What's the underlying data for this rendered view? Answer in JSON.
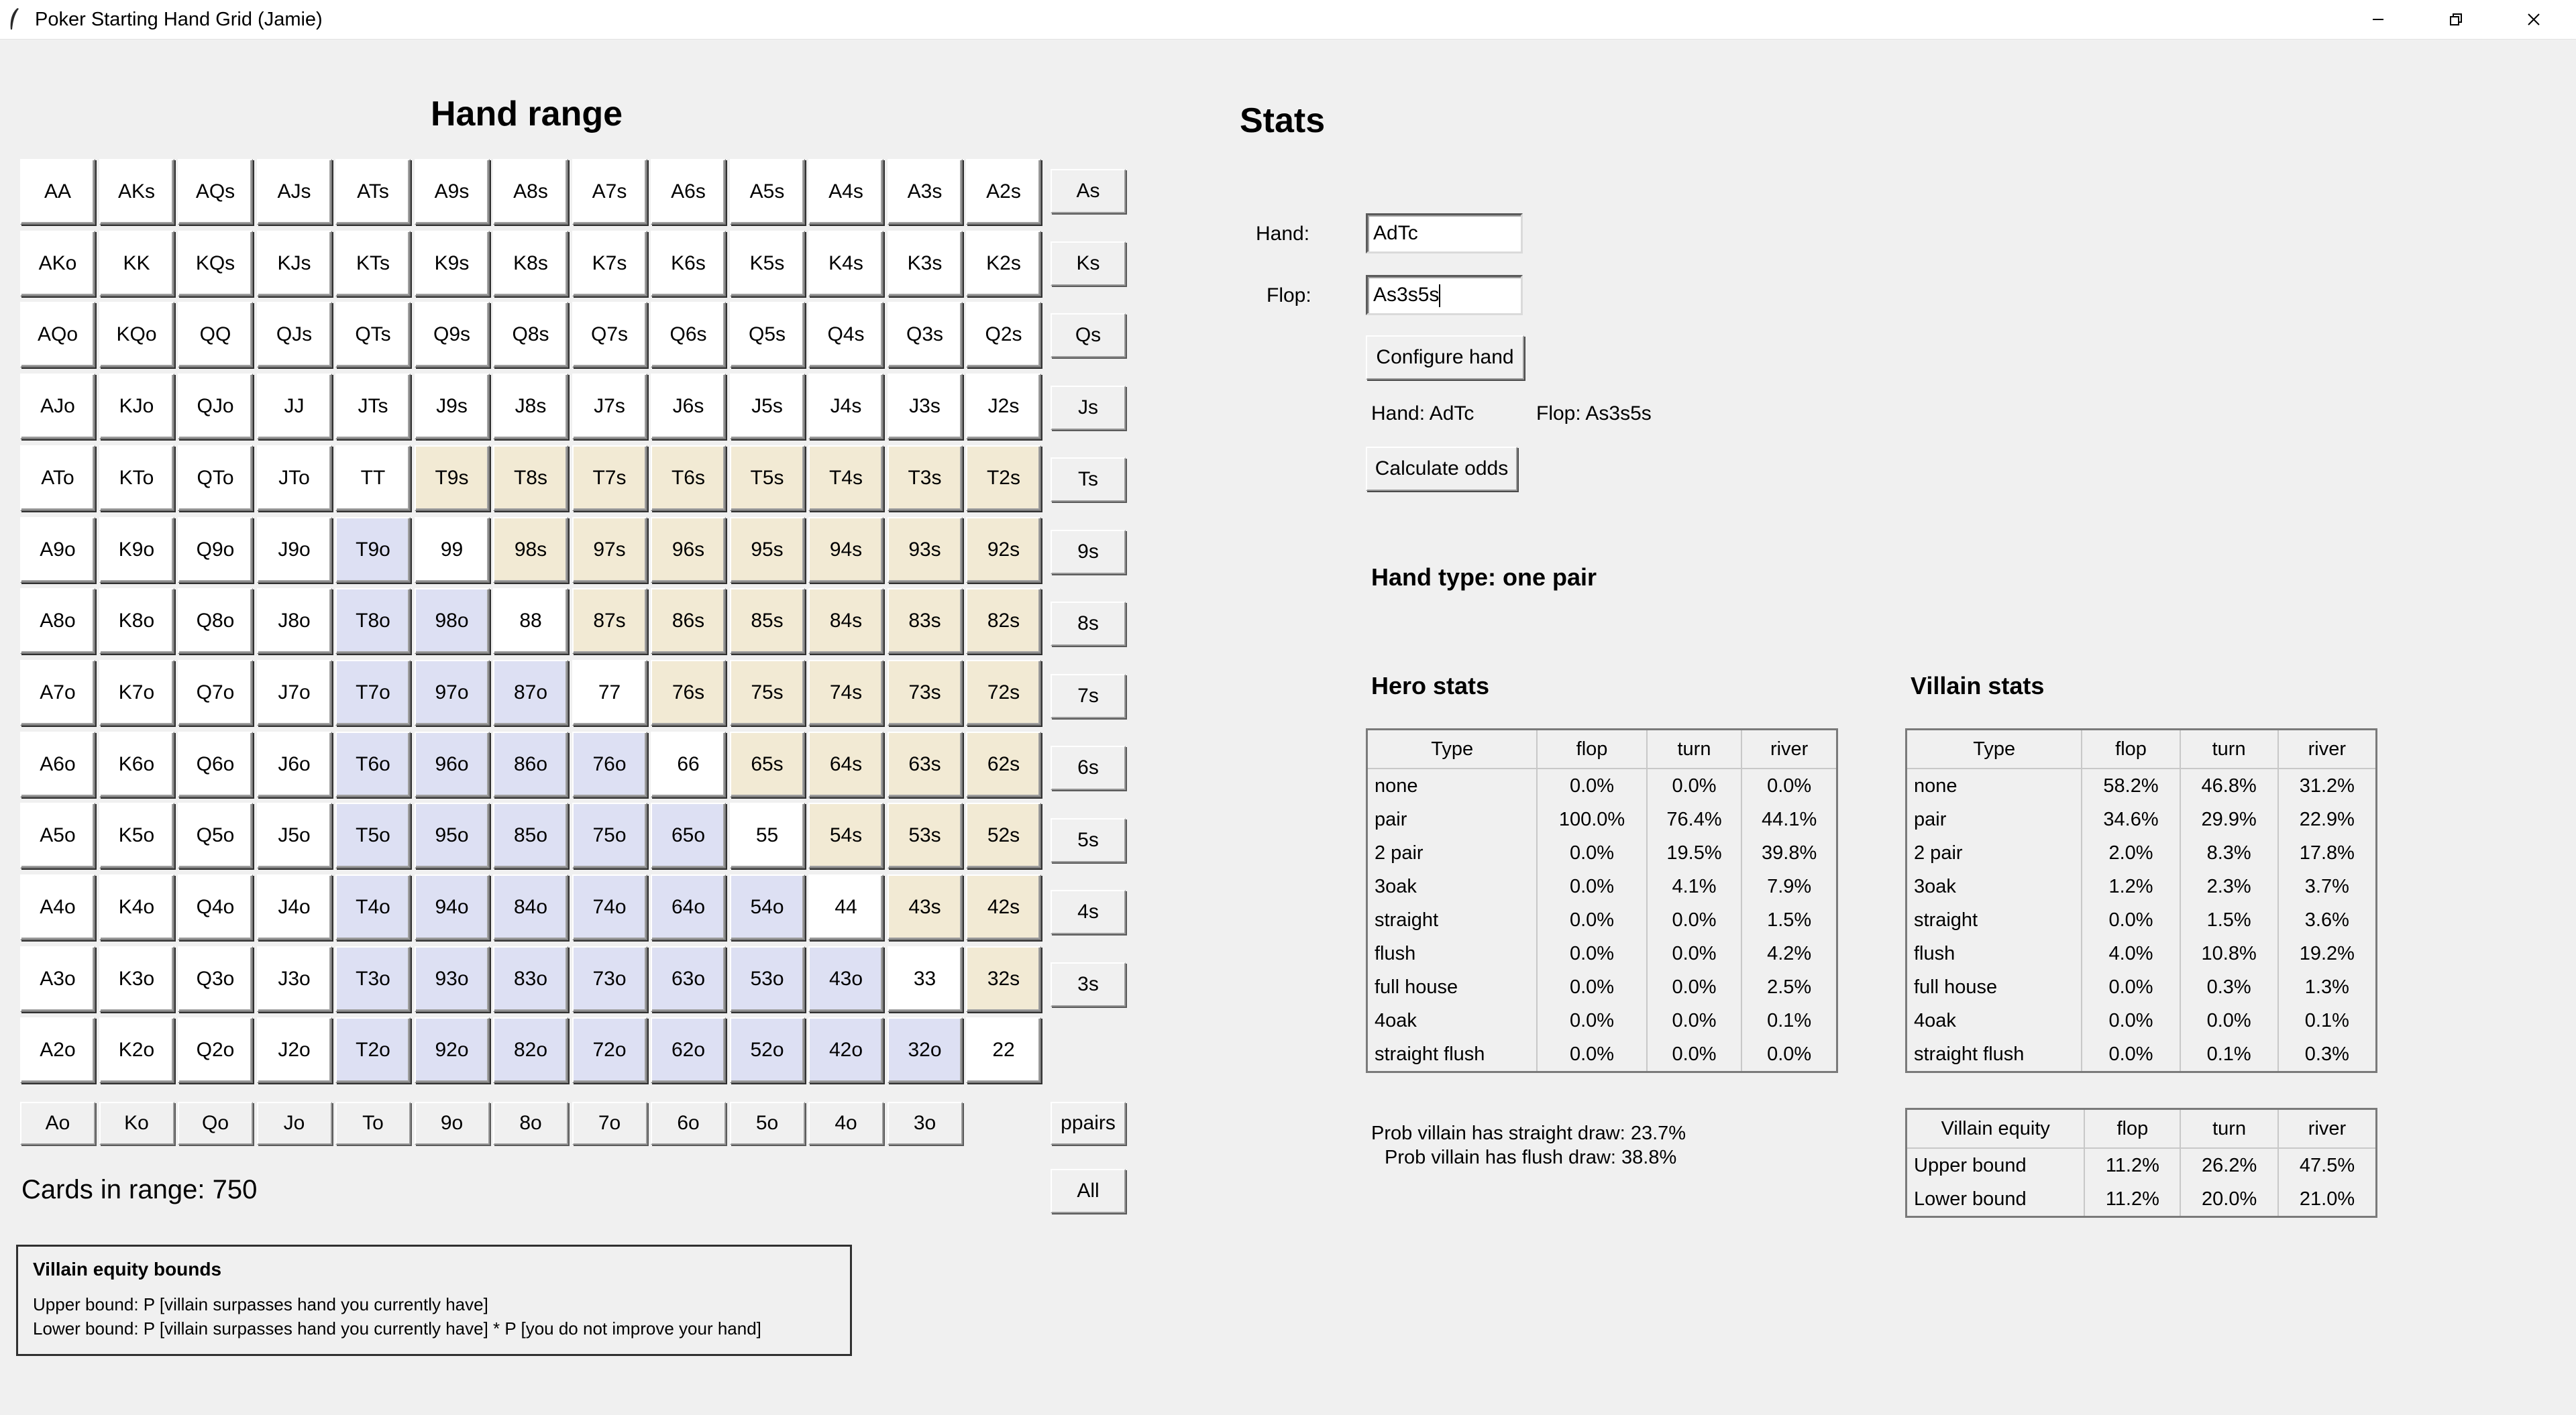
{
  "window": {
    "title": "Poker Starting Hand Grid (Jamie)",
    "icon": "feather-icon"
  },
  "grid": {
    "title": "Hand range",
    "rows": [
      [
        [
          "AA",
          "p"
        ],
        [
          "AKs",
          "n"
        ],
        [
          "AQs",
          "n"
        ],
        [
          "AJs",
          "n"
        ],
        [
          "ATs",
          "n"
        ],
        [
          "A9s",
          "n"
        ],
        [
          "A8s",
          "n"
        ],
        [
          "A7s",
          "n"
        ],
        [
          "A6s",
          "n"
        ],
        [
          "A5s",
          "n"
        ],
        [
          "A4s",
          "n"
        ],
        [
          "A3s",
          "n"
        ],
        [
          "A2s",
          "n"
        ]
      ],
      [
        [
          "AKo",
          "n"
        ],
        [
          "KK",
          "p"
        ],
        [
          "KQs",
          "n"
        ],
        [
          "KJs",
          "n"
        ],
        [
          "KTs",
          "n"
        ],
        [
          "K9s",
          "n"
        ],
        [
          "K8s",
          "n"
        ],
        [
          "K7s",
          "n"
        ],
        [
          "K6s",
          "n"
        ],
        [
          "K5s",
          "n"
        ],
        [
          "K4s",
          "n"
        ],
        [
          "K3s",
          "n"
        ],
        [
          "K2s",
          "n"
        ]
      ],
      [
        [
          "AQo",
          "n"
        ],
        [
          "KQo",
          "n"
        ],
        [
          "QQ",
          "p"
        ],
        [
          "QJs",
          "n"
        ],
        [
          "QTs",
          "n"
        ],
        [
          "Q9s",
          "n"
        ],
        [
          "Q8s",
          "n"
        ],
        [
          "Q7s",
          "n"
        ],
        [
          "Q6s",
          "n"
        ],
        [
          "Q5s",
          "n"
        ],
        [
          "Q4s",
          "n"
        ],
        [
          "Q3s",
          "n"
        ],
        [
          "Q2s",
          "n"
        ]
      ],
      [
        [
          "AJo",
          "n"
        ],
        [
          "KJo",
          "n"
        ],
        [
          "QJo",
          "n"
        ],
        [
          "JJ",
          "p"
        ],
        [
          "JTs",
          "n"
        ],
        [
          "J9s",
          "n"
        ],
        [
          "J8s",
          "n"
        ],
        [
          "J7s",
          "n"
        ],
        [
          "J6s",
          "n"
        ],
        [
          "J5s",
          "n"
        ],
        [
          "J4s",
          "n"
        ],
        [
          "J3s",
          "n"
        ],
        [
          "J2s",
          "n"
        ]
      ],
      [
        [
          "ATo",
          "n"
        ],
        [
          "KTo",
          "n"
        ],
        [
          "QTo",
          "n"
        ],
        [
          "JTo",
          "n"
        ],
        [
          "TT",
          "p"
        ],
        [
          "T9s",
          "s"
        ],
        [
          "T8s",
          "s"
        ],
        [
          "T7s",
          "s"
        ],
        [
          "T6s",
          "s"
        ],
        [
          "T5s",
          "s"
        ],
        [
          "T4s",
          "s"
        ],
        [
          "T3s",
          "s"
        ],
        [
          "T2s",
          "s"
        ]
      ],
      [
        [
          "A9o",
          "n"
        ],
        [
          "K9o",
          "n"
        ],
        [
          "Q9o",
          "n"
        ],
        [
          "J9o",
          "n"
        ],
        [
          "T9o",
          "o"
        ],
        [
          "99",
          "p"
        ],
        [
          "98s",
          "s"
        ],
        [
          "97s",
          "s"
        ],
        [
          "96s",
          "s"
        ],
        [
          "95s",
          "s"
        ],
        [
          "94s",
          "s"
        ],
        [
          "93s",
          "s"
        ],
        [
          "92s",
          "s"
        ]
      ],
      [
        [
          "A8o",
          "n"
        ],
        [
          "K8o",
          "n"
        ],
        [
          "Q8o",
          "n"
        ],
        [
          "J8o",
          "n"
        ],
        [
          "T8o",
          "o"
        ],
        [
          "98o",
          "o"
        ],
        [
          "88",
          "p"
        ],
        [
          "87s",
          "s"
        ],
        [
          "86s",
          "s"
        ],
        [
          "85s",
          "s"
        ],
        [
          "84s",
          "s"
        ],
        [
          "83s",
          "s"
        ],
        [
          "82s",
          "s"
        ]
      ],
      [
        [
          "A7o",
          "n"
        ],
        [
          "K7o",
          "n"
        ],
        [
          "Q7o",
          "n"
        ],
        [
          "J7o",
          "n"
        ],
        [
          "T7o",
          "o"
        ],
        [
          "97o",
          "o"
        ],
        [
          "87o",
          "o"
        ],
        [
          "77",
          "p"
        ],
        [
          "76s",
          "s"
        ],
        [
          "75s",
          "s"
        ],
        [
          "74s",
          "s"
        ],
        [
          "73s",
          "s"
        ],
        [
          "72s",
          "s"
        ]
      ],
      [
        [
          "A6o",
          "n"
        ],
        [
          "K6o",
          "n"
        ],
        [
          "Q6o",
          "n"
        ],
        [
          "J6o",
          "n"
        ],
        [
          "T6o",
          "o"
        ],
        [
          "96o",
          "o"
        ],
        [
          "86o",
          "o"
        ],
        [
          "76o",
          "o"
        ],
        [
          "66",
          "p"
        ],
        [
          "65s",
          "s"
        ],
        [
          "64s",
          "s"
        ],
        [
          "63s",
          "s"
        ],
        [
          "62s",
          "s"
        ]
      ],
      [
        [
          "A5o",
          "n"
        ],
        [
          "K5o",
          "n"
        ],
        [
          "Q5o",
          "n"
        ],
        [
          "J5o",
          "n"
        ],
        [
          "T5o",
          "o"
        ],
        [
          "95o",
          "o"
        ],
        [
          "85o",
          "o"
        ],
        [
          "75o",
          "o"
        ],
        [
          "65o",
          "o"
        ],
        [
          "55",
          "p"
        ],
        [
          "54s",
          "s"
        ],
        [
          "53s",
          "s"
        ],
        [
          "52s",
          "s"
        ]
      ],
      [
        [
          "A4o",
          "n"
        ],
        [
          "K4o",
          "n"
        ],
        [
          "Q4o",
          "n"
        ],
        [
          "J4o",
          "n"
        ],
        [
          "T4o",
          "o"
        ],
        [
          "94o",
          "o"
        ],
        [
          "84o",
          "o"
        ],
        [
          "74o",
          "o"
        ],
        [
          "64o",
          "o"
        ],
        [
          "54o",
          "o"
        ],
        [
          "44",
          "p"
        ],
        [
          "43s",
          "s"
        ],
        [
          "42s",
          "s"
        ]
      ],
      [
        [
          "A3o",
          "n"
        ],
        [
          "K3o",
          "n"
        ],
        [
          "Q3o",
          "n"
        ],
        [
          "J3o",
          "n"
        ],
        [
          "T3o",
          "o"
        ],
        [
          "93o",
          "o"
        ],
        [
          "83o",
          "o"
        ],
        [
          "73o",
          "o"
        ],
        [
          "63o",
          "o"
        ],
        [
          "53o",
          "o"
        ],
        [
          "43o",
          "o"
        ],
        [
          "33",
          "p"
        ],
        [
          "32s",
          "s"
        ]
      ],
      [
        [
          "A2o",
          "n"
        ],
        [
          "K2o",
          "n"
        ],
        [
          "Q2o",
          "n"
        ],
        [
          "J2o",
          "n"
        ],
        [
          "T2o",
          "o"
        ],
        [
          "92o",
          "o"
        ],
        [
          "82o",
          "o"
        ],
        [
          "72o",
          "o"
        ],
        [
          "62o",
          "o"
        ],
        [
          "52o",
          "o"
        ],
        [
          "42o",
          "o"
        ],
        [
          "32o",
          "o"
        ],
        [
          "22",
          "p"
        ]
      ]
    ],
    "side_buttons": [
      "As",
      "Ks",
      "Qs",
      "Js",
      "Ts",
      "9s",
      "8s",
      "7s",
      "6s",
      "5s",
      "4s",
      "3s"
    ],
    "bottom_buttons": [
      "Ao",
      "Ko",
      "Qo",
      "Jo",
      "To",
      "9o",
      "8o",
      "7o",
      "6o",
      "5o",
      "4o",
      "3o"
    ],
    "ppairs_label": "ppairs",
    "all_label": "All",
    "cards_in_range": "Cards in range: 750",
    "colors": {
      "suited": "#f2ead4",
      "offsuit": "#dde0f3",
      "unselected": "#ffffff"
    }
  },
  "legend": {
    "title": "Villain equity bounds",
    "upper": "Upper bound: P [villain surpasses hand you currently have]",
    "lower": "Lower bound: P [villain surpasses hand you currently have] * P [you do not improve your hand]"
  },
  "stats": {
    "title": "Stats",
    "hand_label": "Hand:",
    "hand_value": "AdTc",
    "flop_label": "Flop:",
    "flop_value": "As3s5s",
    "configure_button": "Configure hand",
    "hand_status": "Hand: AdTc",
    "flop_status": "Flop: As3s5s",
    "calculate_button": "Calculate odds",
    "hand_type": "Hand type: one pair",
    "hero_title": "Hero stats",
    "villain_title": "Villain stats",
    "headers": [
      "Type",
      "flop",
      "turn",
      "river"
    ],
    "hero_rows": [
      [
        "none",
        "0.0%",
        "0.0%",
        "0.0%"
      ],
      [
        "pair",
        "100.0%",
        "76.4%",
        "44.1%"
      ],
      [
        "2 pair",
        "0.0%",
        "19.5%",
        "39.8%"
      ],
      [
        "3oak",
        "0.0%",
        "4.1%",
        "7.9%"
      ],
      [
        "straight",
        "0.0%",
        "0.0%",
        "1.5%"
      ],
      [
        "flush",
        "0.0%",
        "0.0%",
        "4.2%"
      ],
      [
        "full house",
        "0.0%",
        "0.0%",
        "2.5%"
      ],
      [
        "4oak",
        "0.0%",
        "0.0%",
        "0.1%"
      ],
      [
        "straight flush",
        "0.0%",
        "0.0%",
        "0.0%"
      ]
    ],
    "villain_rows": [
      [
        "none",
        "58.2%",
        "46.8%",
        "31.2%"
      ],
      [
        "pair",
        "34.6%",
        "29.9%",
        "22.9%"
      ],
      [
        "2 pair",
        "2.0%",
        "8.3%",
        "17.8%"
      ],
      [
        "3oak",
        "1.2%",
        "2.3%",
        "3.7%"
      ],
      [
        "straight",
        "0.0%",
        "1.5%",
        "3.6%"
      ],
      [
        "flush",
        "4.0%",
        "10.8%",
        "19.2%"
      ],
      [
        "full house",
        "0.0%",
        "0.3%",
        "1.3%"
      ],
      [
        "4oak",
        "0.0%",
        "0.0%",
        "0.1%"
      ],
      [
        "straight flush",
        "0.0%",
        "0.1%",
        "0.3%"
      ]
    ],
    "straight_draw": "Prob villain has straight draw: 23.7%",
    "flush_draw": "Prob villain has flush draw: 38.8%",
    "equity_headers": [
      "Villain equity",
      "flop",
      "turn",
      "river"
    ],
    "equity_rows": [
      [
        "Upper bound",
        "11.2%",
        "26.2%",
        "47.5%"
      ],
      [
        "Lower bound",
        "11.2%",
        "20.0%",
        "21.0%"
      ]
    ]
  }
}
